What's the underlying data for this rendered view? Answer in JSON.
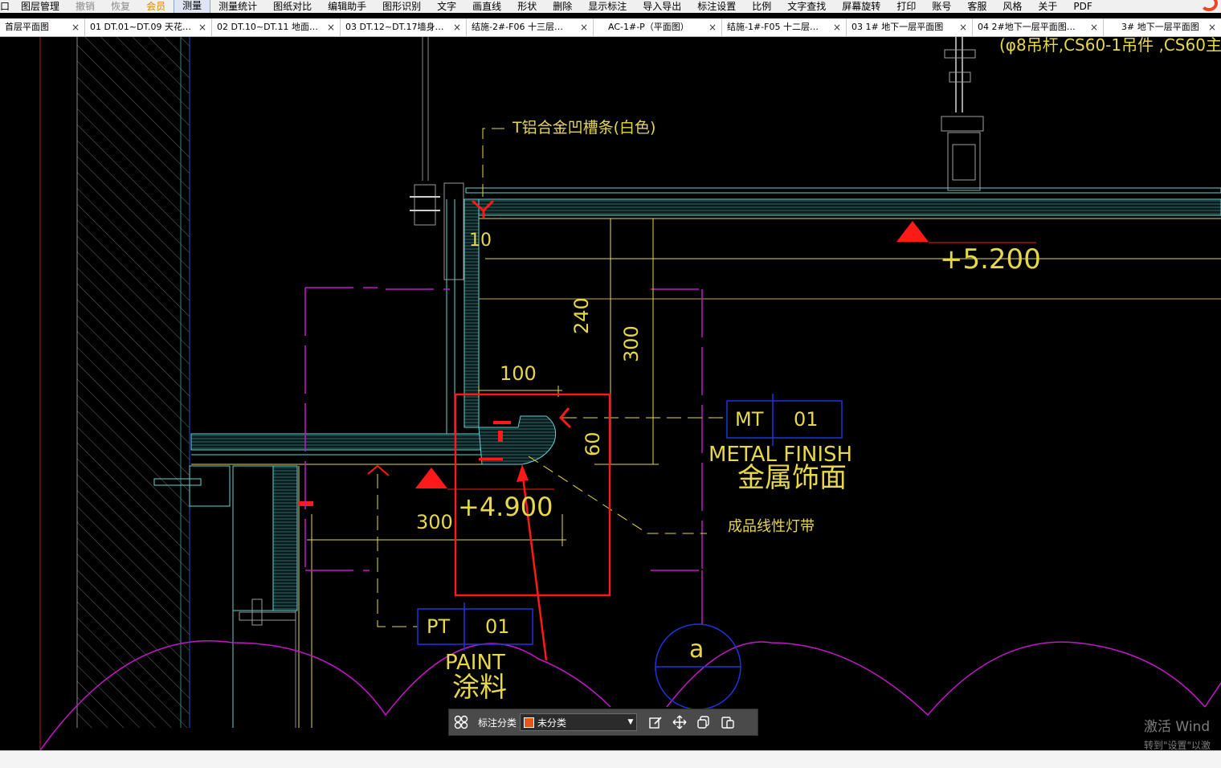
{
  "menubar": {
    "items": [
      "口",
      "图层管理",
      "撤销",
      "恢复",
      "会员",
      "测量",
      "测量统计",
      "图纸对比",
      "编辑助手",
      "图形识别",
      "文字",
      "画直线",
      "形状",
      "删除",
      "显示标注",
      "导入导出",
      "标注设置",
      "比例",
      "文字查找",
      "屏幕旋转",
      "打印",
      "账号",
      "客服",
      "风格",
      "关于",
      "PDF"
    ]
  },
  "tabs": [
    {
      "label": "首层平面图"
    },
    {
      "label": "01 DT.01~DT.09 天花…"
    },
    {
      "label": "02 DT.10~DT.11 地面…"
    },
    {
      "label": "03 DT.12~DT.17墙身…"
    },
    {
      "label": "结施-2#-F06 十三层…"
    },
    {
      "label": "AC-1#-P（平面图）"
    },
    {
      "label": "结施-1#-F05 十二层…"
    },
    {
      "label": "03 1# 地下一层平面图"
    },
    {
      "label": "04 2#地下一层平面图…"
    },
    {
      "label": "3# 地下一层平面图"
    }
  ],
  "close_glyph": "×",
  "drawing": {
    "top_note": "(φ8吊杆,CS60-1吊件 ,CS60主",
    "t_strip_label": "T铝合金凹槽条(白色)",
    "dim_10": "10",
    "elev_upper": "+5.200",
    "dim_240": "240",
    "dim_300_vertical": "300",
    "dim_100": "100",
    "dim_60": "60",
    "tag_mt_code": "MT",
    "tag_mt_num": "01",
    "metal_finish_en": "METAL FINISH",
    "metal_finish_cn": "金属饰面",
    "elev_lower": "+4.900",
    "dim_300_horizontal": "300",
    "led_strip_label": "成品线性灯带",
    "tag_pt_code": "PT",
    "tag_pt_num": "01",
    "paint_en": "PAINT",
    "paint_cn": "涂料",
    "section_mark": "a"
  },
  "annotation_toolbar": {
    "category_label": "标注分类",
    "category_value": "未分类",
    "swatch_color": "#e3571c"
  },
  "watermark": {
    "line1": "激活 Wind",
    "line2": "转到\"设置\"以激"
  },
  "colors": {
    "cad_yellow": "#e6d84a",
    "cad_magenta": "#c218c8",
    "cad_blue": "#2233e0",
    "cad_red": "#ff1a1a",
    "cad_cyan": "#5fd3d6"
  }
}
